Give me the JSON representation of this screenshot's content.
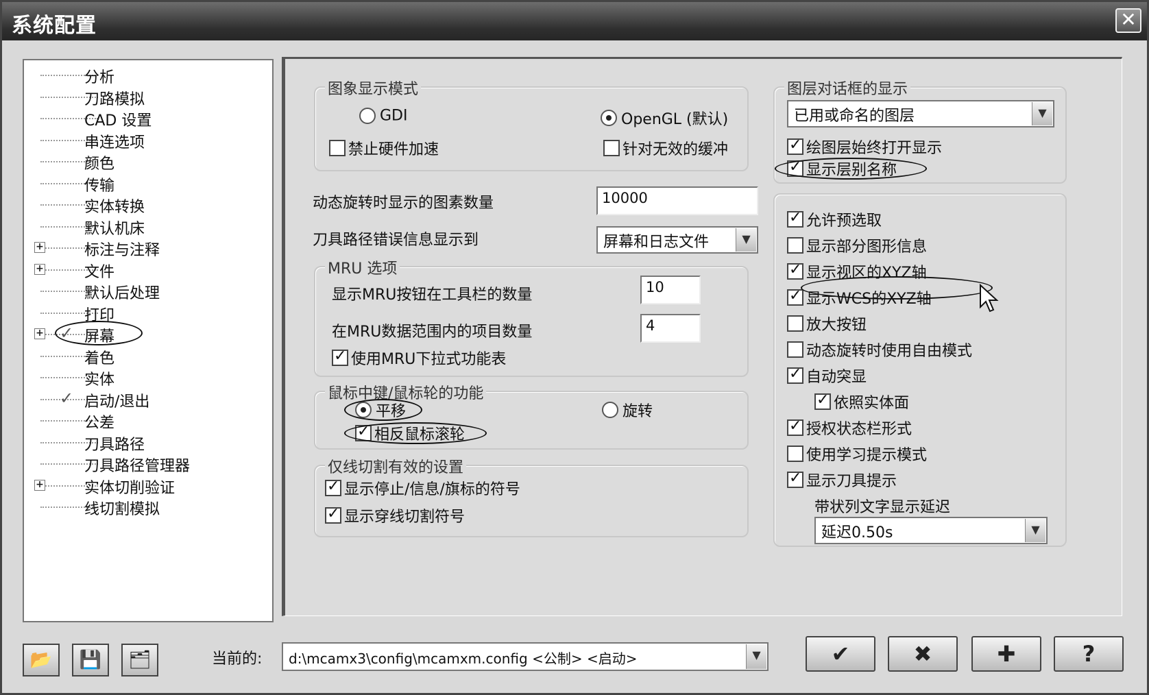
{
  "window": {
    "title": "系统配置",
    "close_glyph": "✕"
  },
  "tree": {
    "items": [
      {
        "label": "分析",
        "expandable": false,
        "checked": false
      },
      {
        "label": "刀路模拟",
        "expandable": false,
        "checked": false
      },
      {
        "label": "CAD 设置",
        "expandable": false,
        "checked": false
      },
      {
        "label": "串连选项",
        "expandable": false,
        "checked": false
      },
      {
        "label": "颜色",
        "expandable": false,
        "checked": false
      },
      {
        "label": "传输",
        "expandable": false,
        "checked": false
      },
      {
        "label": "实体转换",
        "expandable": false,
        "checked": false
      },
      {
        "label": "默认机床",
        "expandable": false,
        "checked": false
      },
      {
        "label": "标注与注释",
        "expandable": true,
        "checked": false
      },
      {
        "label": "文件",
        "expandable": true,
        "checked": false
      },
      {
        "label": "默认后处理",
        "expandable": false,
        "checked": false
      },
      {
        "label": "打印",
        "expandable": false,
        "checked": false
      },
      {
        "label": "屏幕",
        "expandable": true,
        "checked": true,
        "highlighted": true
      },
      {
        "label": "着色",
        "expandable": false,
        "checked": false
      },
      {
        "label": "实体",
        "expandable": false,
        "checked": false
      },
      {
        "label": "启动/退出",
        "expandable": false,
        "checked": true
      },
      {
        "label": "公差",
        "expandable": false,
        "checked": false
      },
      {
        "label": "刀具路径",
        "expandable": false,
        "checked": false
      },
      {
        "label": "刀具路径管理器",
        "expandable": false,
        "checked": false
      },
      {
        "label": "实体切削验证",
        "expandable": true,
        "checked": false
      },
      {
        "label": "线切割模拟",
        "expandable": false,
        "checked": false
      }
    ]
  },
  "image_mode": {
    "title": "图象显示模式",
    "gdi": "GDI",
    "opengl": "OpenGL (默认)",
    "disable_hw_accel": "禁止硬件加速",
    "invalid_buffer": "针对无效的缓冲"
  },
  "dynamic_rotation_label": "动态旋转时显示的图素数量",
  "dynamic_rotation_value": "10000",
  "toolpath_error_label": "刀具路径错误信息显示到",
  "toolpath_error_value": "屏幕和日志文件",
  "mru": {
    "title": "MRU 选项",
    "toolbar_count_label": "显示MRU按钮在工具栏的数量",
    "toolbar_count_value": "10",
    "range_count_label": "在MRU数据范围内的项目数量",
    "range_count_value": "4",
    "use_dropdown": "使用MRU下拉式功能表"
  },
  "mouse": {
    "title": "鼠标中键/鼠标轮的功能",
    "pan": "平移",
    "rotate": "旋转",
    "reverse_wheel": "相反鼠标滚轮"
  },
  "wire": {
    "title": "仅线切割有效的设置",
    "show_stop": "显示停止/信息/旗标的符号",
    "show_thread": "显示穿线切割符号"
  },
  "layers": {
    "title": "图层对话框的显示",
    "combo_value": "已用或命名的图层",
    "always_open": "绘图层始终打开显示",
    "show_names": "显示层别名称"
  },
  "options": [
    {
      "label": "允许预选取",
      "checked": true
    },
    {
      "label": "显示部分图形信息",
      "checked": false
    },
    {
      "label": "显示视区的XYZ轴",
      "checked": true
    },
    {
      "label": "显示WCS的XYZ轴",
      "checked": true
    },
    {
      "label": "放大按钮",
      "checked": false
    },
    {
      "label": "动态旋转时使用自由模式",
      "checked": false
    },
    {
      "label": "自动突显",
      "checked": true
    },
    {
      "label": "依照实体面",
      "checked": true
    },
    {
      "label": "授权状态栏形式",
      "checked": true
    },
    {
      "label": "使用学习提示模式",
      "checked": false
    },
    {
      "label": "显示刀具提示",
      "checked": true
    }
  ],
  "tooltip_delay": {
    "label": "带状列文字显示延迟",
    "value": "延迟0.50s"
  },
  "footer": {
    "current_label": "当前的:",
    "current_path": "d:\\mcamx3\\config\\mcamxm.config <公制> <启动>",
    "ok_glyph": "✔",
    "cancel_glyph": "✖",
    "add_glyph": "✚",
    "help_glyph": "?"
  }
}
